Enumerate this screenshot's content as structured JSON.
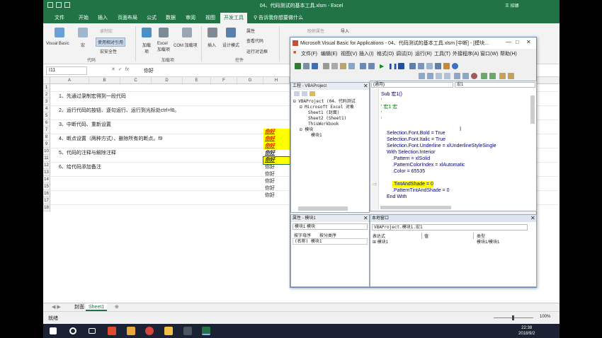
{
  "excel": {
    "title": "04、代码测试的基本工具.xlsm - Excel",
    "user": "王 招娜",
    "tabs": [
      "文件",
      "开始",
      "插入",
      "页面布局",
      "公式",
      "数据",
      "审阅",
      "视图",
      "开发工具"
    ],
    "active_tab": "开发工具",
    "tell_me": "告诉我你想要做什么",
    "ribbon": {
      "code_group": "代码",
      "visual_basic": "Visual Basic",
      "macros": "宏",
      "record_macro": "录制宏",
      "relative_ref": "使用相对引用",
      "macro_security": "宏安全性",
      "addins_group": "加载项",
      "addins": "加载项",
      "excel_addins": "Excel 加载项",
      "com_addins": "COM 加载项",
      "controls_group": "控件",
      "insert": "插入",
      "design_mode": "设计模式",
      "properties": "属性",
      "view_code": "查看代码",
      "run_dialog": "运行对话框",
      "map_props": "映射属性",
      "import": "导入"
    },
    "name_box": "I11",
    "formula_value": "你好",
    "columns": [
      "A",
      "B",
      "C",
      "D",
      "E",
      "F",
      "G",
      "H",
      "I"
    ],
    "rows": [
      "1",
      "2",
      "3",
      "4",
      "5",
      "6",
      "7",
      "8",
      "9",
      "10",
      "11",
      "12",
      "13",
      "14",
      "15",
      "16",
      "17",
      "18"
    ],
    "notes": [
      "1、先通过录制宏得到一段代码",
      "2、运行代码的按钮、逐句运行、运行到光标处ctrl+f8。",
      "3、中断代码、重新设置",
      "4、断点设置（两种方式）、删除所有的断点。f9",
      "5、代码的注释与解除注释",
      "6、给代码添加备注"
    ],
    "column_i": [
      "你好",
      "你好",
      "你好",
      "你好",
      "你好",
      "你好",
      "你好",
      "你好",
      "你好",
      "你好"
    ],
    "sheets": [
      "封面",
      "Sheet1"
    ],
    "active_sheet": "Sheet1",
    "status": "就绪",
    "zoom": "100%"
  },
  "vba": {
    "title": "Microsoft Visual Basic for Applications - 04、代码测试的基本工具.xlsm [中断] - [模块...",
    "menu": [
      "文件(F)",
      "编辑(E)",
      "视图(V)",
      "插入(I)",
      "格式(O)",
      "调试(D)",
      "运行(R)",
      "工具(T)",
      "外接程序(A)",
      "窗口(W)",
      "帮助(H)"
    ],
    "project_title": "工程 - VBAProject",
    "project_tree": [
      "VBAProject (04、代码测试",
      "Microsoft Excel 对象",
      "Sheet1 (封面)",
      "Sheet2 (Sheet1)",
      "ThisWorkbook",
      "模块",
      "模块1"
    ],
    "properties_title": "属性 - 模块1",
    "properties_object": "模块1 模块",
    "prop_tabs": [
      "按字母序",
      "按分类序"
    ],
    "prop_name_row": "(名称) 模块1",
    "code_object": "(通用)",
    "code_proc": "宏1",
    "code_lines": [
      "Sub 宏1()",
      "'",
      "' 宏1 宏",
      "'",
      "'",
      "    Selection.Font.Bold = True",
      "    Selection.Font.Italic = True",
      "    Selection.Font.Underline = xlUnderlineStyleSingle",
      "    With Selection.Interior",
      "        .Pattern = xlSolid",
      "        .PatternColorIndex = xlAutomatic",
      "        .Color = 65535",
      "",
      "        .TintAndShade = 0",
      "        .PatternTintAndShade = 0",
      "    End With"
    ],
    "locals_title": "本地窗口",
    "locals_context": "VBAProject.模块1.宏1",
    "locals_headers": [
      "表达式",
      "值",
      "类型"
    ],
    "locals_row": [
      "模块1",
      "",
      "模块1/模块1"
    ]
  },
  "taskbar": {
    "time": "22:38",
    "date": "2018/9/2"
  },
  "colors": {
    "excel_green": "#217346",
    "highlight": "#ffff00",
    "code_blue": "#00008b",
    "comment_green": "#008000"
  }
}
